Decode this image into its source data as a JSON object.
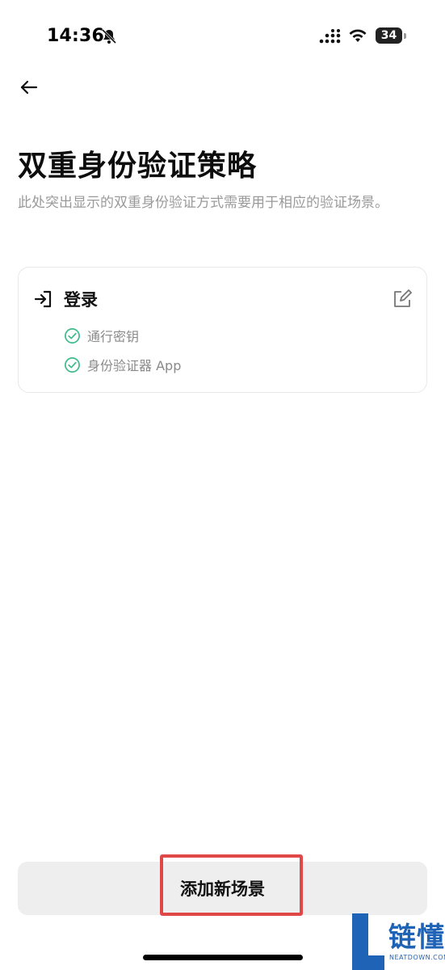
{
  "status_bar": {
    "time": "14:36",
    "battery": "34",
    "icons": [
      "bell-muted-icon",
      "signal-icon",
      "wifi-icon",
      "battery-icon"
    ]
  },
  "nav": {
    "back_icon": "arrow-left-icon"
  },
  "header": {
    "title": "双重身份验证策略",
    "description": "此处突出显示的双重身份验证方式需要用于相应的验证场景。"
  },
  "card": {
    "title": "登录",
    "head_icon": "sign-in-icon",
    "edit_icon": "edit-icon",
    "methods": [
      {
        "label": "通行密钥",
        "icon": "check-circle-icon"
      },
      {
        "label": "身份验证器 App",
        "icon": "check-circle-icon"
      }
    ],
    "accent": "#3dbb8a"
  },
  "footer": {
    "add_button_label": "添加新场景",
    "highlight_color": "#e04848"
  },
  "watermark": {
    "text": "链懂",
    "sub": "NEATDOWN.COM",
    "color": "#1f63b6"
  }
}
